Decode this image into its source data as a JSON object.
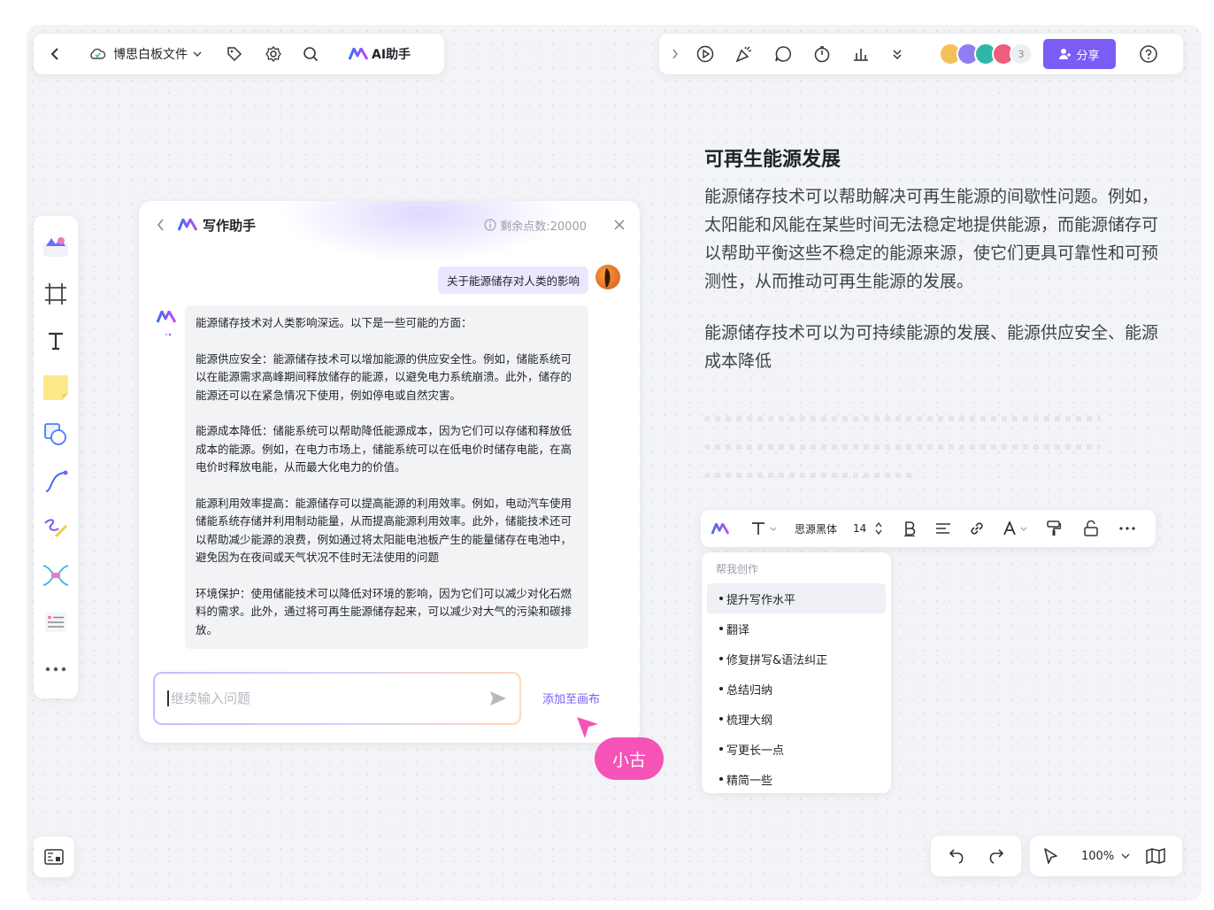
{
  "app": {
    "file_title": "博思白板文件",
    "ai_assistant_label": "AI助手",
    "collaborator_count": "3",
    "share_label": "分享"
  },
  "chat": {
    "title": "写作助手",
    "points": "剩余点数:20000",
    "question": "关于能源储存对人类的影响",
    "answer": [
      "能源储存技术对人类影响深远。以下是一些可能的方面：",
      "能源供应安全：能源储存技术可以增加能源的供应安全性。例如，储能系统可以在能源需求高峰期间释放储存的能源，以避免电力系统崩溃。此外，储存的能源还可以在紧急情况下使用，例如停电或自然灾害。",
      "能源成本降低：储能系统可以帮助降低能源成本，因为它们可以存储和释放低成本的能源。例如，在电力市场上，储能系统可以在低电价时储存电能，在高电价时释放电能，从而最大化电力的价值。",
      "能源利用效率提高：能源储存可以提高能源的利用效率。例如，电动汽车使用储能系统存储并利用制动能量，从而提高能源利用效率。此外，储能技术还可以帮助减少能源的浪费，例如通过将太阳能电池板产生的能量储存在电池中，避免因为在夜间或天气状况不佳时无法使用的问题",
      "环境保护：使用储能技术可以降低对环境的影响，因为它们可以减少对化石燃料的需求。此外，通过将可再生能源储存起来，可以减少对大气的污染和碳排放。"
    ],
    "input_placeholder": "继续输入问题",
    "add_to_canvas": "添加至画布"
  },
  "cursor_tag": "小古",
  "document": {
    "heading": "可再生能源发展",
    "para1": "能源储存技术可以帮助解决可再生能源的间歇性问题。例如，太阳能和风能在某些时间无法稳定地提供能源，而能源储存可以帮助平衡这些不稳定的能源来源，使它们更具可靠性和可预测性，从而推动可再生能源的发展。",
    "para2": "能源储存技术可以为可持续能源的发展、能源供应安全、能源成本降低"
  },
  "format_toolbar": {
    "font": "思源黑体",
    "size": "14"
  },
  "help_menu": {
    "header": "帮我创作",
    "items": [
      "提升写作水平",
      "翻译",
      "修复拼写&语法纠正",
      "总结归纳",
      "梳理大纲",
      "写更长一点",
      "精简一些"
    ]
  },
  "zoom": "100%",
  "colors": {
    "accent": "#7b5cf5",
    "tag": "#f553b7"
  }
}
